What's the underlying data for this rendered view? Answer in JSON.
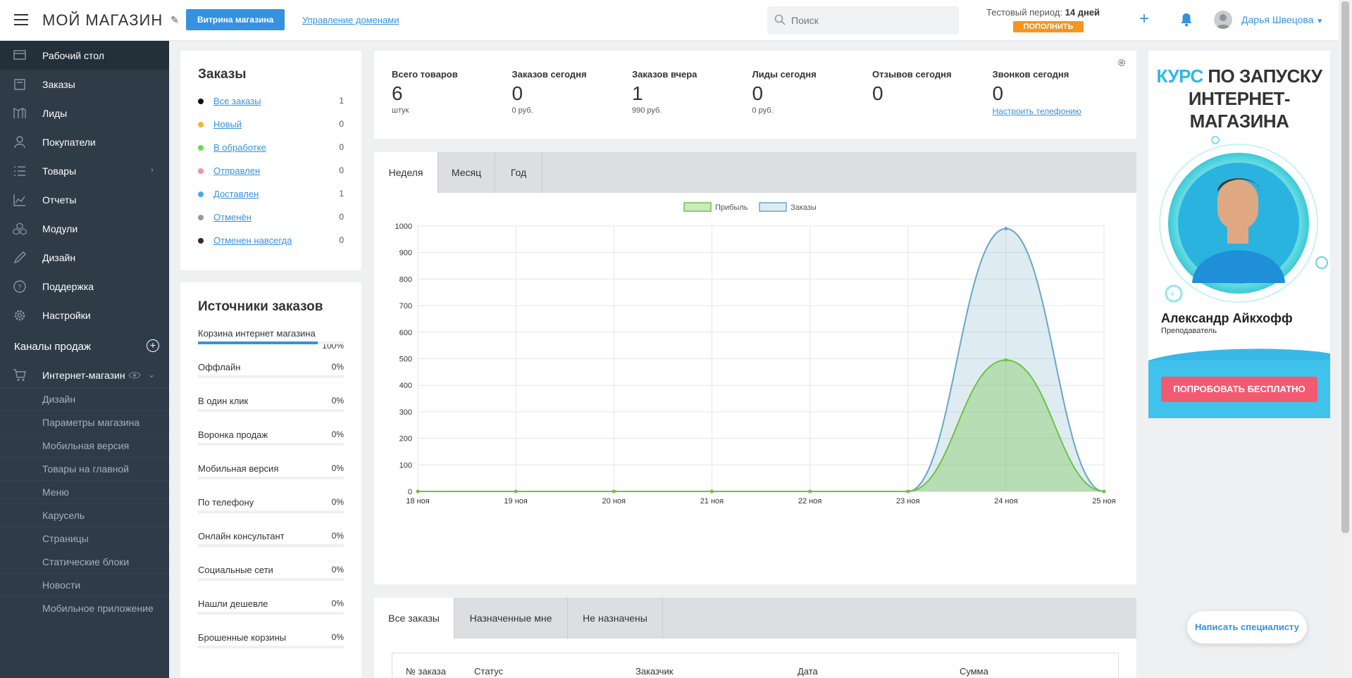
{
  "header": {
    "brand": "МОЙ МАГАЗИН",
    "storefront_button": "Витрина магазина",
    "domains_link": "Управление доменами",
    "search_placeholder": "Поиск",
    "trial_label": "Тестовый период:",
    "trial_days": "14 дней",
    "topup_button": "ПОПОЛНИТЬ",
    "user_name": "Дарья Швецова",
    "accent_color": "#3592e0"
  },
  "sidebar": {
    "items": [
      {
        "label": "Рабочий стол",
        "icon": "desktop-icon"
      },
      {
        "label": "Заказы",
        "icon": "orders-icon"
      },
      {
        "label": "Лиды",
        "icon": "leads-icon"
      },
      {
        "label": "Покупатели",
        "icon": "customers-icon"
      },
      {
        "label": "Товары",
        "icon": "products-icon"
      },
      {
        "label": "Отчеты",
        "icon": "reports-icon"
      },
      {
        "label": "Модули",
        "icon": "modules-icon"
      },
      {
        "label": "Дизайн",
        "icon": "design-icon"
      },
      {
        "label": "Поддержка",
        "icon": "support-icon"
      },
      {
        "label": "Настройки",
        "icon": "settings-icon"
      }
    ],
    "channels_title": "Каналы продаж",
    "shop_label": "Интернет-магазин",
    "shop_subitems": [
      "Дизайн",
      "Параметры магазина",
      "Мобильная версия",
      "Товары на главной",
      "Меню",
      "Карусель",
      "Страницы",
      "Статические блоки",
      "Новости",
      "Мобильное приложение"
    ]
  },
  "orders": {
    "title": "Заказы",
    "statuses": [
      {
        "label": "Все заказы",
        "count": "1",
        "color": "#111111"
      },
      {
        "label": "Новый",
        "count": "0",
        "color": "#f5b335"
      },
      {
        "label": "В обработке",
        "count": "0",
        "color": "#5ee04f"
      },
      {
        "label": "Отправлен",
        "count": "0",
        "color": "#f58fab"
      },
      {
        "label": "Доставлен",
        "count": "1",
        "color": "#4fa7e6"
      },
      {
        "label": "Отменён",
        "count": "0",
        "color": "#9a9a9a"
      },
      {
        "label": "Отменен навсегда",
        "count": "0",
        "color": "#3a2a20"
      }
    ]
  },
  "sources": {
    "title": "Источники заказов",
    "items": [
      {
        "label": "Корзина интернет магазина",
        "percent": "100%",
        "value": 100
      },
      {
        "label": "Оффлайн",
        "percent": "0%",
        "value": 0
      },
      {
        "label": "В один клик",
        "percent": "0%",
        "value": 0
      },
      {
        "label": "Воронка продаж",
        "percent": "0%",
        "value": 0
      },
      {
        "label": "Мобильная версия",
        "percent": "0%",
        "value": 0
      },
      {
        "label": "По телефону",
        "percent": "0%",
        "value": 0
      },
      {
        "label": "Онлайн консультант",
        "percent": "0%",
        "value": 0
      },
      {
        "label": "Социальные сети",
        "percent": "0%",
        "value": 0
      },
      {
        "label": "Нашли дешевле",
        "percent": "0%",
        "value": 0
      },
      {
        "label": "Брошенные корзины",
        "percent": "0%",
        "value": 0
      }
    ]
  },
  "stats": [
    {
      "label": "Всего товаров",
      "value": "6",
      "sub": "штук"
    },
    {
      "label": "Заказов сегодня",
      "value": "0",
      "sub": "0 руб."
    },
    {
      "label": "Заказов вчера",
      "value": "1",
      "sub": "990 руб."
    },
    {
      "label": "Лиды сегодня",
      "value": "0",
      "sub": "0 руб."
    },
    {
      "label": "Отзывов сегодня",
      "value": "0",
      "sub": ""
    },
    {
      "label": "Звонков сегодня",
      "value": "0",
      "link": "Настроить телефонию"
    }
  ],
  "chart_tabs": [
    "Неделя",
    "Месяц",
    "Год"
  ],
  "chart_data": {
    "type": "area",
    "categories": [
      "18 ноя",
      "19 ноя",
      "20 ноя",
      "21 ноя",
      "22 ноя",
      "23 ноя",
      "24 ноя",
      "25 ноя"
    ],
    "series": [
      {
        "name": "Прибыль",
        "values": [
          0,
          0,
          0,
          0,
          0,
          0,
          495,
          0
        ],
        "color": "#6fc243"
      },
      {
        "name": "Заказы",
        "values": [
          0,
          0,
          0,
          0,
          0,
          0,
          990,
          0
        ],
        "color": "#6aa7c4"
      }
    ],
    "ylim": [
      0,
      1000
    ],
    "yticks": [
      0,
      100,
      200,
      300,
      400,
      500,
      600,
      700,
      800,
      900,
      1000
    ],
    "grid": true,
    "legend": "top-center"
  },
  "table": {
    "tabs": [
      "Все заказы",
      "Назначенные мне",
      "Не назначены"
    ],
    "columns": [
      "№ заказа",
      "Статус",
      "Заказчик",
      "Дата",
      "Сумма"
    ]
  },
  "ad": {
    "title_highlight": "КУРС",
    "title_rest_1": "ПО ЗАПУСКУ",
    "title_line_2": "ИНТЕРНЕТ-МАГАЗИНА",
    "name": "Александр Айкхофф",
    "role": "Преподаватель",
    "button": "ПОПРОБОВАТЬ БЕСПЛАТНО"
  },
  "chat_button": "Написать специалисту"
}
